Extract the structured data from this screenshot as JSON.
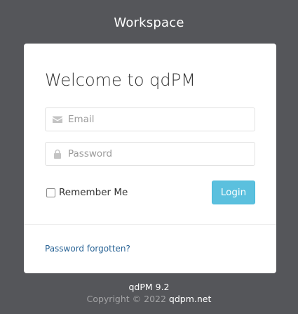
{
  "header": {
    "title": "Workspace"
  },
  "login_form": {
    "title": "Welcome to qdPM",
    "email": {
      "placeholder": "Email",
      "value": "",
      "icon": "envelope-icon"
    },
    "password": {
      "placeholder": "Password",
      "value": "",
      "icon": "lock-icon"
    },
    "remember_me": {
      "label": "Remember Me",
      "checked": false
    },
    "login_button": "Login",
    "forgot_password_link": "Password forgotten?"
  },
  "footer": {
    "version": "qdPM 9.2",
    "copyright_prefix": "Copyright © 2022",
    "site_link": "qdpm.net"
  },
  "colors": {
    "background": "#55565a",
    "card": "#ffffff",
    "login_button": "#5bc0de",
    "link": "#2a6496",
    "icon": "#c4c4c4"
  }
}
